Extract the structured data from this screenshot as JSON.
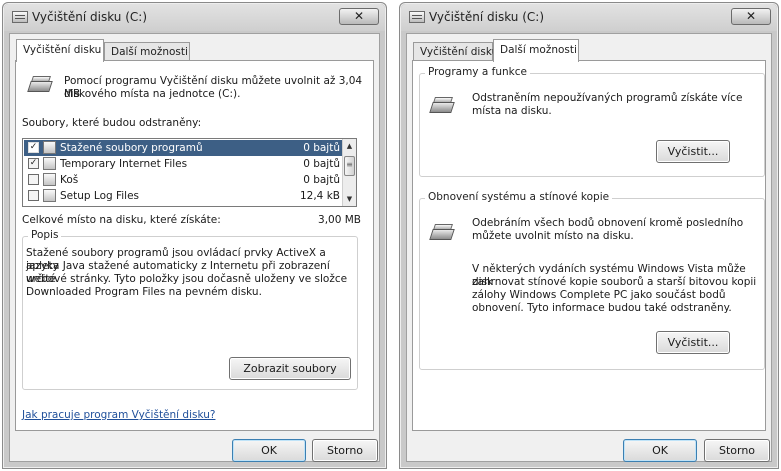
{
  "left_window": {
    "title": "Vyčištění disku  (C:)",
    "close_symbol": "✕",
    "tabs": [
      "Vyčištění disku",
      "Další možnosti"
    ],
    "intro_line1": "Pomocí programu Vyčištění disku můžete uvolnit až 3,04 MB",
    "intro_line2": "diskového místa na jednotce  (C:).",
    "files_label": "Soubory, které budou odstraněny:",
    "files": [
      {
        "name": "Stažené soubory programů",
        "size": "0 bajtů",
        "checked": true,
        "selected": true
      },
      {
        "name": "Temporary Internet Files",
        "size": "0 bajtů",
        "checked": true,
        "selected": false
      },
      {
        "name": "Koš",
        "size": "0 bajtů",
        "checked": false,
        "selected": false
      },
      {
        "name": "Setup Log Files",
        "size": "12,4 kB",
        "checked": false,
        "selected": false
      }
    ],
    "total_label": "Celkové místo na disku, které získáte:",
    "total_value": "3,00 MB",
    "description_legend": "Popis",
    "description_lines": [
      "Stažené soubory programů jsou ovládací prvky ActiveX a aplety",
      "jazyka Java stažené automaticky z Internetu při zobrazení určité",
      "webové stránky. Tyto položky jsou dočasně uloženy ve složce",
      "Downloaded Program Files na pevném disku."
    ],
    "view_files_button": "Zobrazit soubory",
    "help_link": "Jak pracuje program Vyčištění disku?",
    "ok_button": "OK",
    "cancel_button": "Storno"
  },
  "right_window": {
    "title": "Vyčištění disku  (C:)",
    "close_symbol": "✕",
    "tabs": [
      "Vyčištění disku",
      "Další možnosti"
    ],
    "programs_group": {
      "legend": "Programy a funkce",
      "text_line1": "Odstraněním nepoužívaných programů získáte více",
      "text_line2": "místa na disku.",
      "button": "Vyčistit..."
    },
    "restore_group": {
      "legend": "Obnovení systému a stínové kopie",
      "text_line1": "Odebráním všech bodů obnovení kromě posledního",
      "text_line2": "můžete uvolnit místo na disku.",
      "note_lines": [
        "V některých vydáních systému Windows Vista může disk",
        "zahrnovat stínové kopie souborů a starší bitovou kopii",
        "zálohy Windows Complete PC jako součást bodů",
        "obnovení. Tyto informace budou také odstraněny."
      ],
      "button": "Vyčistit..."
    },
    "ok_button": "OK",
    "cancel_button": "Storno"
  }
}
